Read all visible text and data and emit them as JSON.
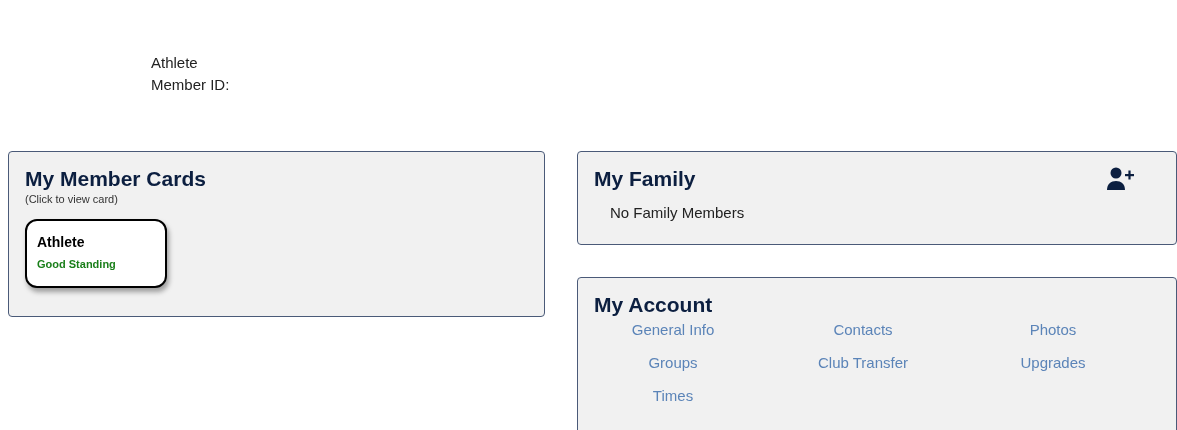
{
  "profile": {
    "role": "Athlete",
    "member_id_label": "Member ID:"
  },
  "member_cards": {
    "title": "My Member Cards",
    "hint": "(Click to view card)",
    "cards": [
      {
        "title": "Athlete",
        "status": "Good Standing",
        "color": "#1a7f1a"
      }
    ]
  },
  "family": {
    "title": "My Family",
    "empty_text": "No Family Members"
  },
  "account": {
    "title": "My Account",
    "links": [
      "General Info",
      "Contacts",
      "Photos",
      "Groups",
      "Club Transfer",
      "Upgrades",
      "Times"
    ]
  }
}
